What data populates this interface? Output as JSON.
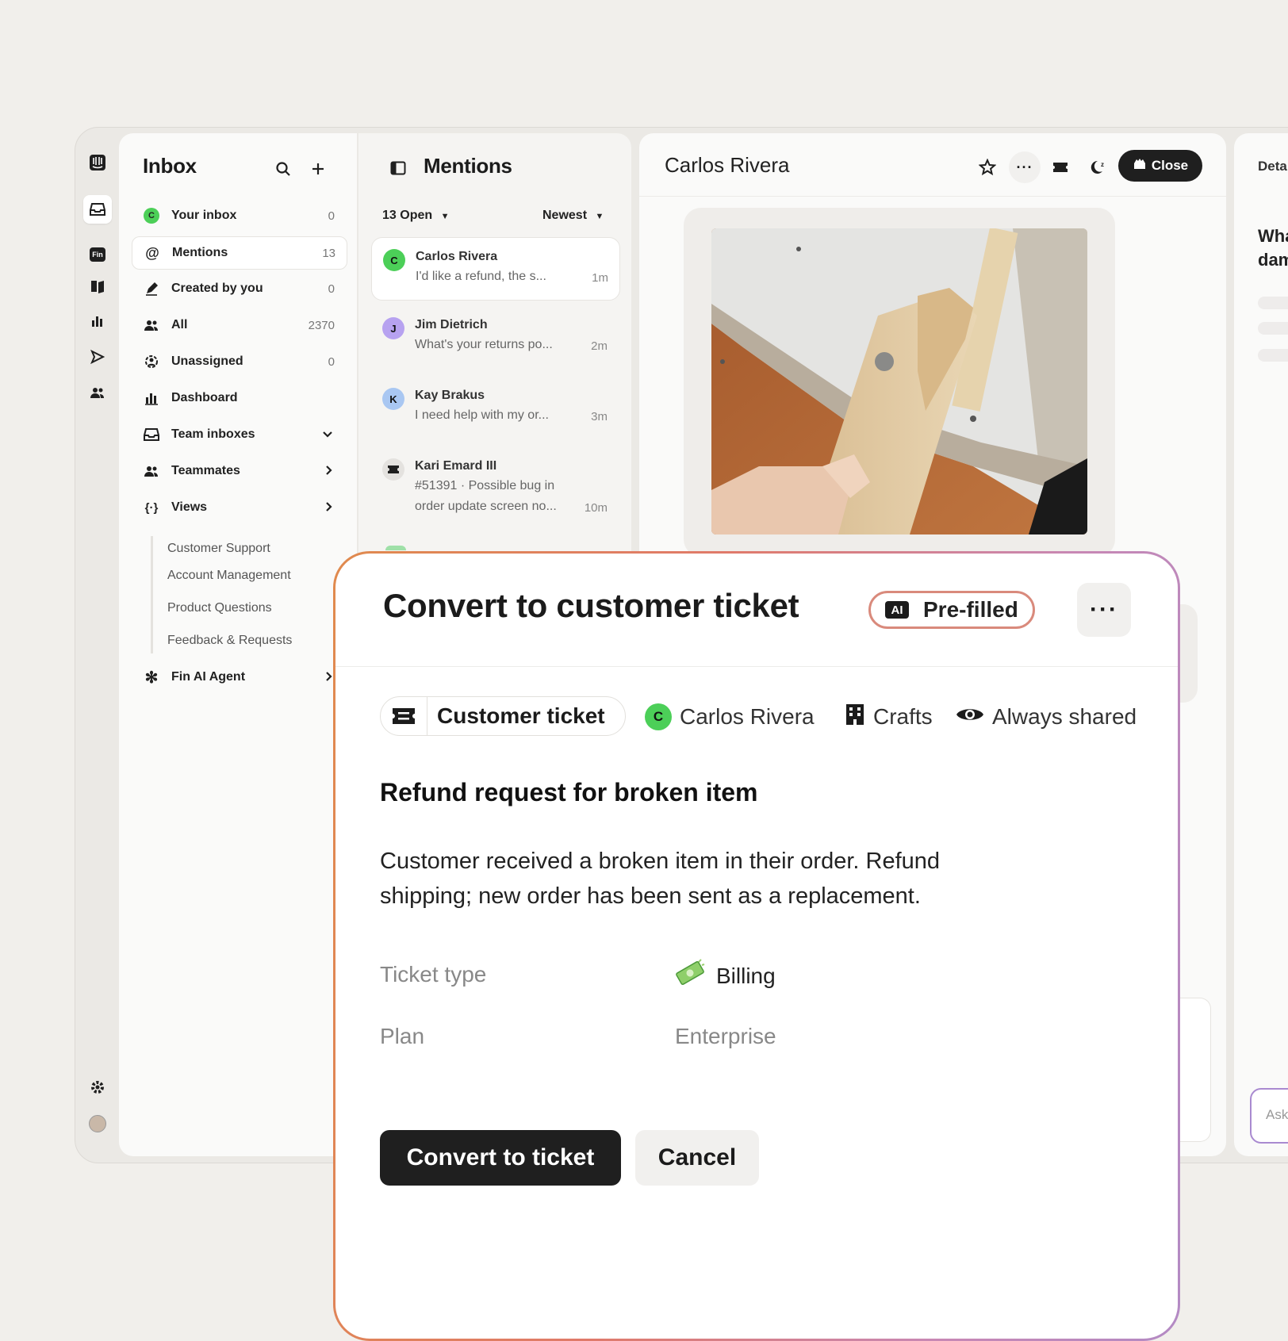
{
  "colors": {
    "accent_dark": "#1f1f1f",
    "avatar_green": "#4ccf58",
    "avatar_purple": "#b7a2f0",
    "avatar_blue": "#a9c7f2",
    "modal_border_start": "#e08a4e",
    "modal_border_end": "#b38ac4"
  },
  "inbox": {
    "title": "Inbox",
    "items": [
      {
        "label": "Your inbox",
        "count": "0",
        "icon": "avatar-c-icon"
      },
      {
        "label": "Mentions",
        "count": "13",
        "icon": "at-icon"
      },
      {
        "label": "Created by you",
        "count": "0",
        "icon": "pen-icon"
      },
      {
        "label": "All",
        "count": "2370",
        "icon": "people-icon"
      },
      {
        "label": "Unassigned",
        "count": "0",
        "icon": "unassigned-icon"
      },
      {
        "label": "Dashboard",
        "count": "",
        "icon": "bar-chart-icon"
      },
      {
        "label": "Team inboxes",
        "count": "",
        "icon": "inbox-icon"
      },
      {
        "label": "Teammates",
        "count": "",
        "icon": "people-icon"
      },
      {
        "label": "Views",
        "count": "",
        "icon": "views-icon"
      }
    ],
    "views": [
      "Customer Support",
      "Account Management",
      "Product Questions",
      "Feedback & Requests"
    ],
    "fin_label": "Fin AI Agent"
  },
  "mentions": {
    "title": "Mentions",
    "filter_open": "13 Open",
    "filter_sort": "Newest",
    "conversations": [
      {
        "initial": "C",
        "name": "Carlos Rivera",
        "preview": "I'd like a refund, the s...",
        "time": "1m"
      },
      {
        "initial": "J",
        "name": "Jim Dietrich",
        "preview": "What's your returns po...",
        "time": "2m"
      },
      {
        "initial": "K",
        "name": "Kay Brakus",
        "preview": "I need help with my or...",
        "time": "3m"
      },
      {
        "initial": "",
        "name": "Kari Emard III",
        "preview": "#51391 · Possible bug in",
        "preview2": "order update screen no...",
        "time": "10m"
      }
    ]
  },
  "conversation": {
    "title": "Carlos Rivera",
    "close_label": "Close"
  },
  "details": {
    "title": "Deta",
    "text1": "Wha",
    "text2": "dam",
    "ask_placeholder": "Ask"
  },
  "modal": {
    "title": "Convert to customer ticket",
    "ai_badge": "AI",
    "prefilled_label": "Pre-filled",
    "ticket_tag": "Customer ticket",
    "customer_initial": "C",
    "customer_name": "Carlos Rivera",
    "company": "Crafts",
    "visibility": "Always shared",
    "heading": "Refund request for broken item",
    "description": "Customer received a broken item in their order. Refund shipping; new order has been sent as a replacement.",
    "fields": [
      {
        "label": "Ticket type",
        "value": "Billing",
        "icon": "money-icon"
      },
      {
        "label": "Plan",
        "value": "Enterprise"
      }
    ],
    "primary_button": "Convert to ticket",
    "secondary_button": "Cancel"
  }
}
